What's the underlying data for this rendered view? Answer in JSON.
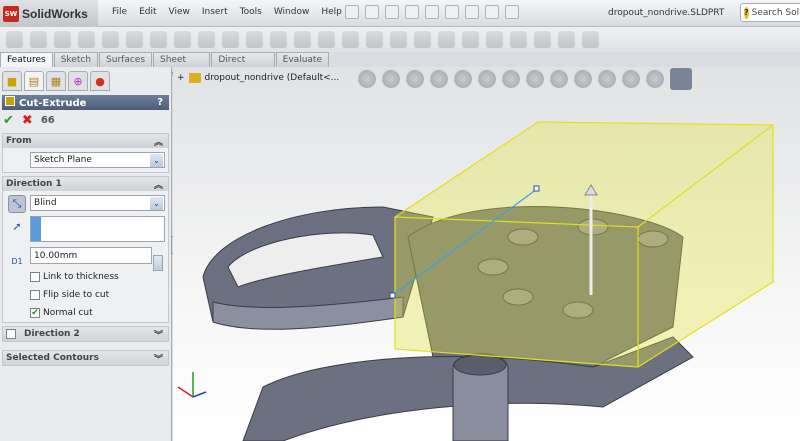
{
  "app": {
    "title": "SolidWorks",
    "logo": "SW",
    "document": "dropout_nondrive.SLDPRT",
    "search_placeholder": "Search SolidWorks"
  },
  "menu": [
    "File",
    "Edit",
    "View",
    "Insert",
    "Tools",
    "Window",
    "Help"
  ],
  "tabs": [
    {
      "label": "Features",
      "active": true
    },
    {
      "label": "Sketch"
    },
    {
      "label": "Surfaces"
    },
    {
      "label": "Sheet Metal"
    },
    {
      "label": "Direct Editing"
    },
    {
      "label": "Evaluate"
    }
  ],
  "tree": {
    "root": "dropout_nondrive  (Default<..."
  },
  "panel": {
    "title": "Cut-Extrude",
    "help": "?",
    "from": {
      "label": "From",
      "value": "Sketch Plane"
    },
    "direction1": {
      "label": "Direction 1",
      "end_condition": "Blind",
      "depth": "10.00mm",
      "dim_label": "D1",
      "options": [
        {
          "label": "Link to thickness",
          "checked": false
        },
        {
          "label": "Flip side to cut",
          "checked": false
        },
        {
          "label": "Normal cut",
          "checked": true
        }
      ]
    },
    "direction2": {
      "label": "Direction 2",
      "checked": false
    },
    "selected_contours": {
      "label": "Selected Contours"
    }
  },
  "colors": {
    "selection_box": "#e8e830",
    "part": "#6b6e7e",
    "header": "#4c5d78"
  }
}
